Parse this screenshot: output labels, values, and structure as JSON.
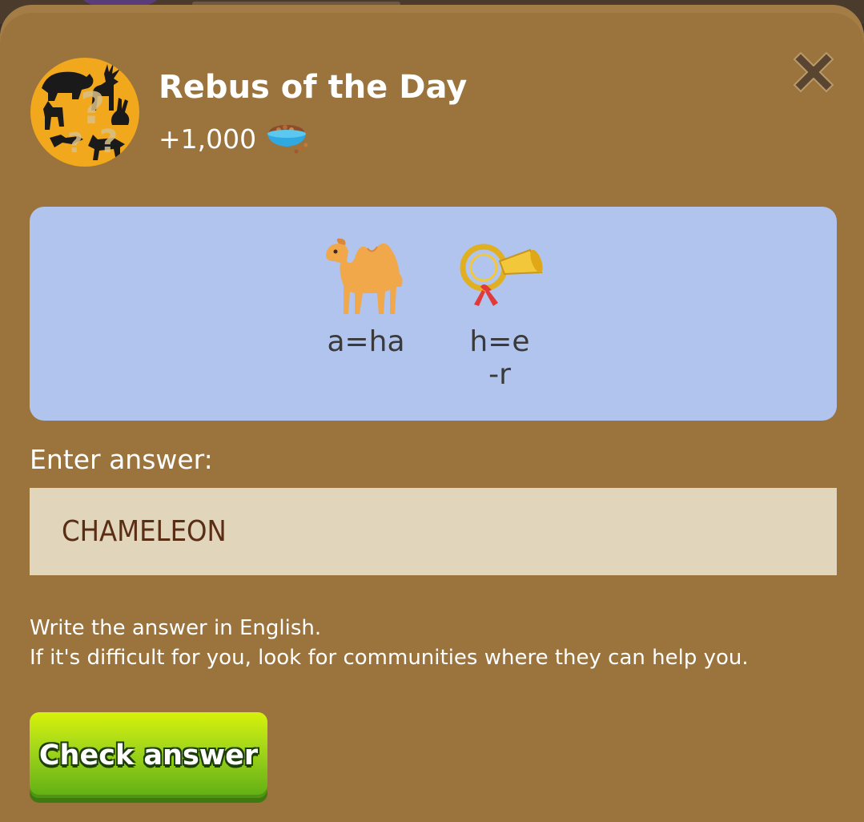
{
  "dialog": {
    "title": "Rebus of the Day",
    "reward_amount": "+1,000",
    "reward_icon": "pet-food-bowl-icon",
    "close_icon": "close-icon"
  },
  "rebus": {
    "items": [
      {
        "icon": "camel-icon",
        "caption_line1": "a=ha",
        "caption_line2": ""
      },
      {
        "icon": "post-horn-icon",
        "caption_line1": "h=e",
        "caption_line2": "-r"
      }
    ]
  },
  "answer": {
    "label": "Enter answer:",
    "value": "CHAMELEON"
  },
  "hint": {
    "line1": "Write the answer in English.",
    "line2": "If it's difficult for you, look for communities where they can help you."
  },
  "actions": {
    "check_label": "Check answer"
  },
  "colors": {
    "dialog_bg": "#9a733d",
    "rebus_bg": "#b0c4ee",
    "answer_bg": "#e1d5bc",
    "answer_text": "#5a2e14",
    "button_green": "#7cc414",
    "avatar_bg": "#f2a81d"
  }
}
